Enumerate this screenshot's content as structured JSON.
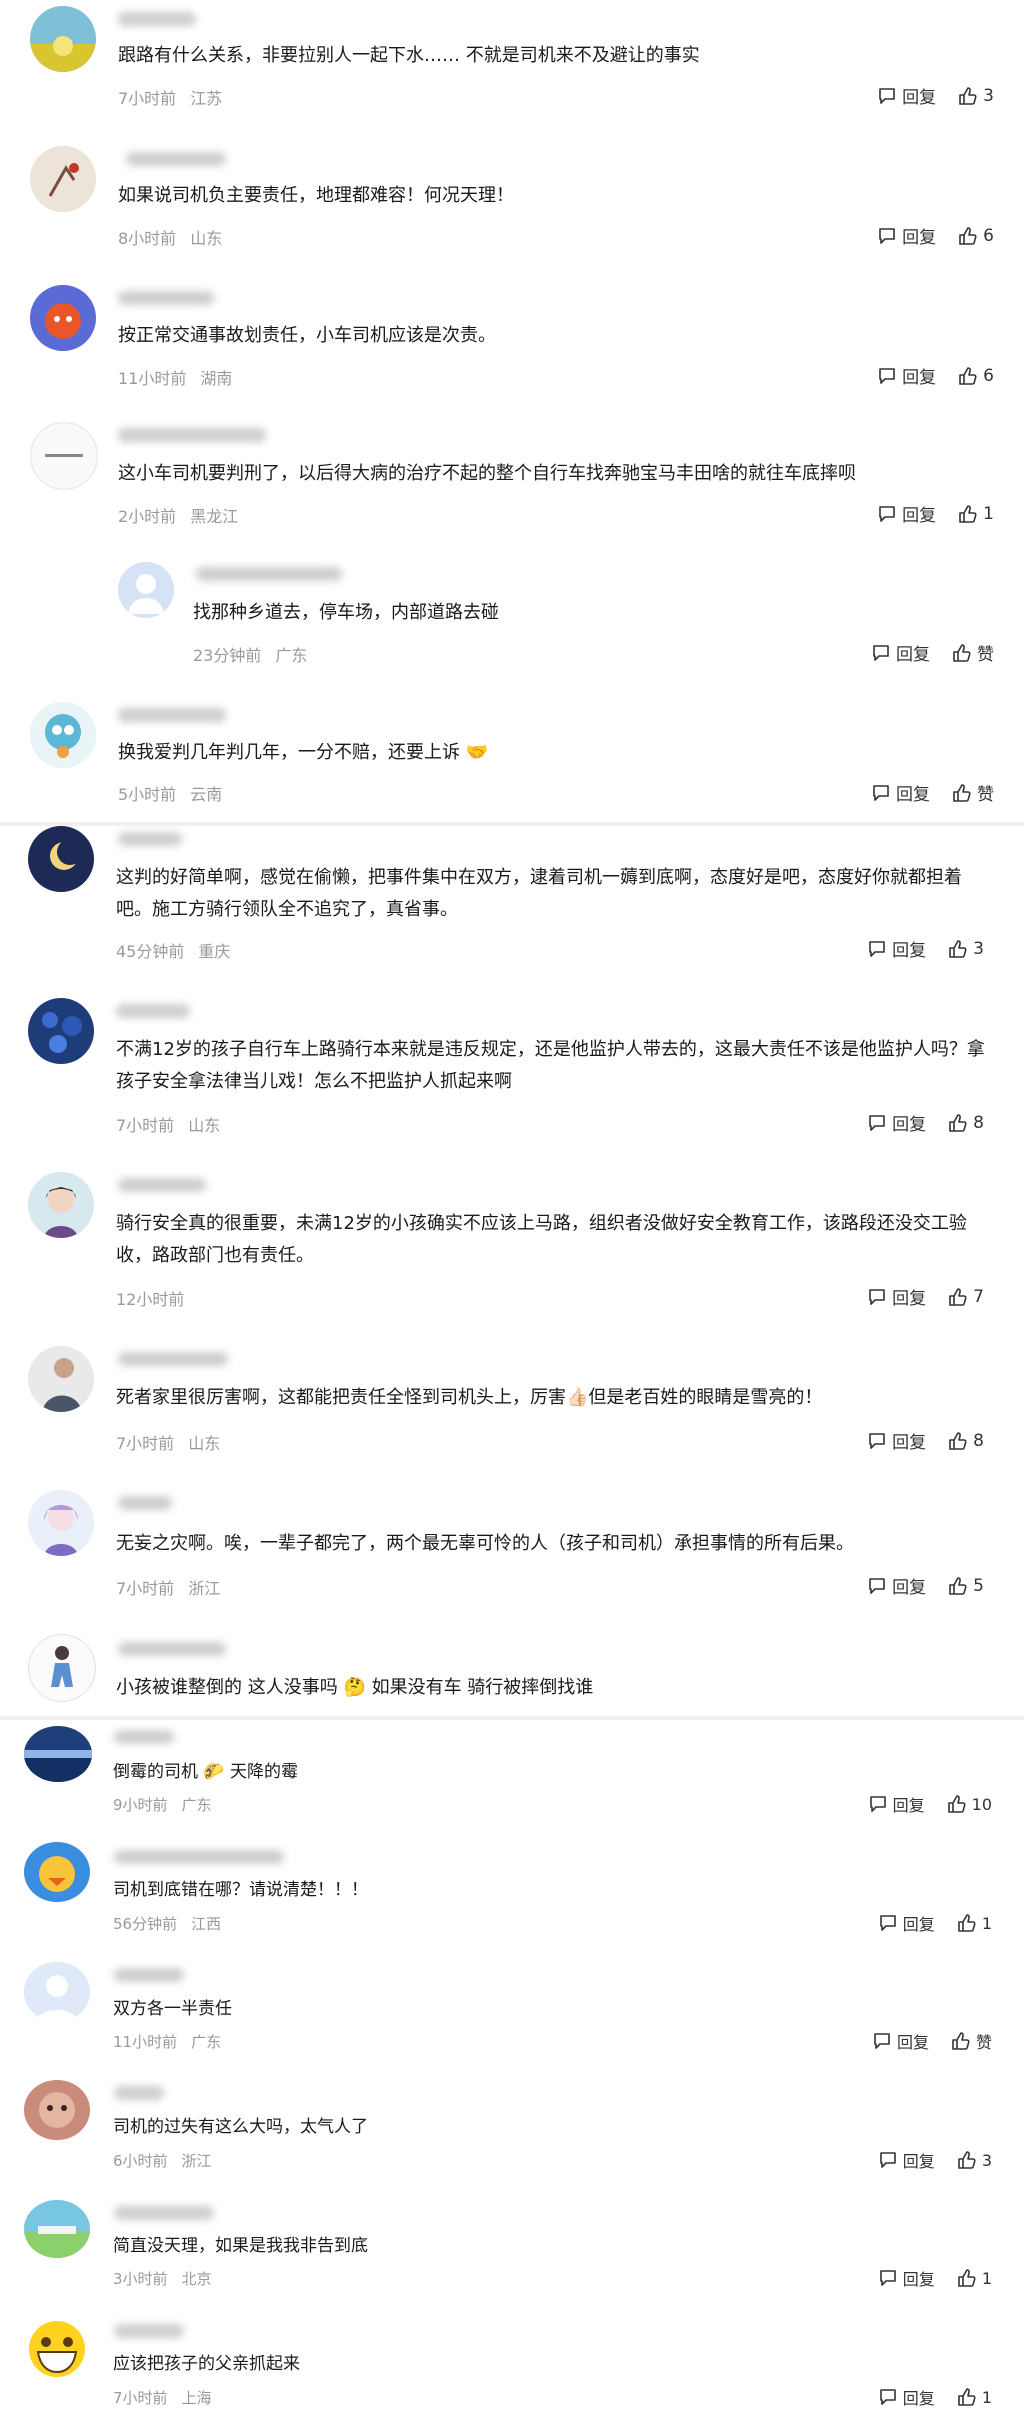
{
  "comments": [
    {
      "text": "跟路有什么关系，非要拉别人一起下水…… 不就是司机来不及避让的事实",
      "time": "7小时前",
      "region": "江苏",
      "reply": "回复",
      "likes": "3"
    },
    {
      "text": "如果说司机负主要责任，地理都难容！何况天理！",
      "time": "8小时前",
      "region": "山东",
      "reply": "回复",
      "likes": "6"
    },
    {
      "text": "按正常交通事故划责任，小车司机应该是次责。",
      "time": "11小时前",
      "region": "湖南",
      "reply": "回复",
      "likes": "6"
    },
    {
      "text": "这小车司机要判刑了，以后得大病的治疗不起的整个自行车找奔驰宝马丰田啥的就往车底摔呗",
      "time": "2小时前",
      "region": "黑龙江",
      "reply": "回复",
      "likes": "1"
    },
    {
      "text": "找那种乡道去，停车场，内部道路去碰",
      "time": "23分钟前",
      "region": "广东",
      "reply": "回复",
      "likes": "赞"
    },
    {
      "text": "换我爱判几年判几年，一分不赔，还要上诉 🤝",
      "time": "5小时前",
      "region": "云南",
      "reply": "回复",
      "likes": "赞"
    },
    {
      "text": "这判的好简单啊，感觉在偷懒，把事件集中在双方，逮着司机一薅到底啊，态度好是吧，态度好你就都担着吧。施工方骑行领队全不追究了，真省事。",
      "time": "45分钟前",
      "region": "重庆",
      "reply": "回复",
      "likes": "3"
    },
    {
      "text": "不满12岁的孩子自行车上路骑行本来就是违反规定，还是他监护人带去的，这最大责任不该是他监护人吗？拿孩子安全拿法律当儿戏！怎么不把监护人抓起来啊",
      "time": "7小时前",
      "region": "山东",
      "reply": "回复",
      "likes": "8"
    },
    {
      "text": "骑行安全真的很重要，未满12岁的小孩确实不应该上马路，组织者没做好安全教育工作，该路段还没交工验收，路政部门也有责任。",
      "time": "12小时前",
      "region": "",
      "reply": "回复",
      "likes": "7"
    },
    {
      "text": "死者家里很厉害啊，这都能把责任全怪到司机头上，厉害👍🏻但是老百姓的眼睛是雪亮的！",
      "time": "7小时前",
      "region": "山东",
      "reply": "回复",
      "likes": "8"
    },
    {
      "text": "无妄之灾啊。唉，一辈子都完了，两个最无辜可怜的人（孩子和司机）承担事情的所有后果。",
      "time": "7小时前",
      "region": "浙江",
      "reply": "回复",
      "likes": "5"
    },
    {
      "text": "小孩被谁整倒的 这人没事吗 🤔 如果没有车 骑行被摔倒找谁",
      "time": "",
      "region": "",
      "reply": "",
      "likes": ""
    },
    {
      "text": "倒霉的司机 🌮 天降的霉",
      "time": "9小时前",
      "region": "广东",
      "reply": "回复",
      "likes": "10"
    },
    {
      "text": "司机到底错在哪？请说清楚！！！",
      "time": "56分钟前",
      "region": "江西",
      "reply": "回复",
      "likes": "1"
    },
    {
      "text": "双方各一半责任",
      "time": "11小时前",
      "region": "广东",
      "reply": "回复",
      "likes": "赞"
    },
    {
      "text": "司机的过失有这么大吗，太气人了",
      "time": "6小时前",
      "region": "浙江",
      "reply": "回复",
      "likes": "3"
    },
    {
      "text": "简直没天理，如果是我我非告到底",
      "time": "3小时前",
      "region": "北京",
      "reply": "回复",
      "likes": "1"
    },
    {
      "text": "应该把孩子的父亲抓起来",
      "time": "7小时前",
      "region": "上海",
      "reply": "回复",
      "likes": "1"
    }
  ]
}
